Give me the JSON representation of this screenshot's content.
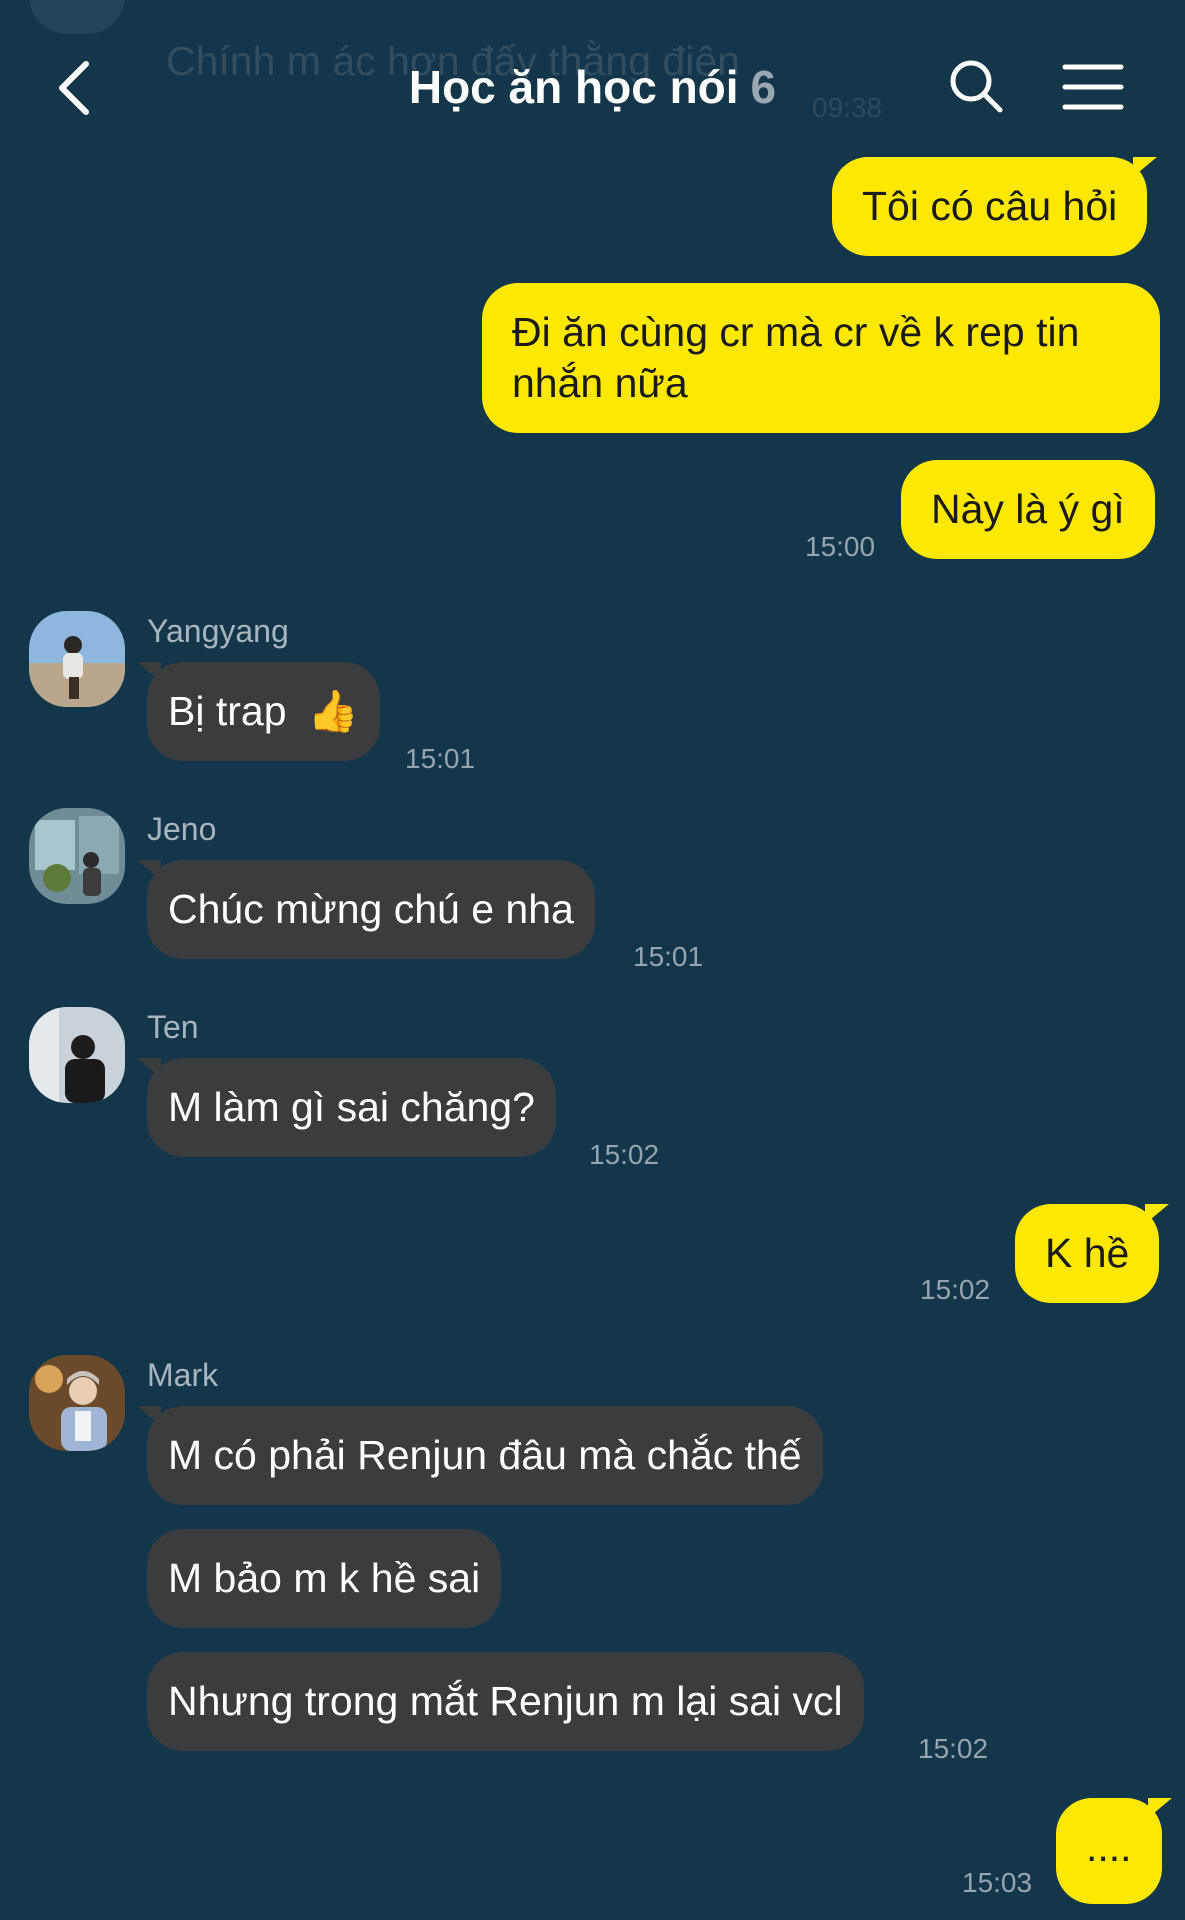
{
  "header": {
    "back_icon": "chevron-left-icon",
    "title": "Học ăn học nói",
    "member_count": "6",
    "search_icon": "search-icon",
    "menu_icon": "hamburger-menu-icon"
  },
  "background_message": {
    "text": "Chính m ác hơn đấy thằng điên",
    "time": "09:38"
  },
  "colors": {
    "background": "#13364a",
    "outgoing_bubble": "#ffe800",
    "incoming_bubble": "#3a3c3e",
    "timestamp": "#97a4ad"
  },
  "messages": [
    {
      "from": "me",
      "text": "Tôi có câu hỏi"
    },
    {
      "from": "me",
      "lines": [
        "Đi ăn cùng cr mà cr về k rep tin",
        "nhắn nữa"
      ]
    },
    {
      "from": "me",
      "text": "Này là ý gì",
      "time": "15:00"
    },
    {
      "from": "Yangyang",
      "sender": "Yangyang",
      "text": "Bị trap",
      "emoji": "👍",
      "time": "15:01"
    },
    {
      "from": "Jeno",
      "sender": "Jeno",
      "text": "Chúc mừng chú e nha",
      "time": "15:01"
    },
    {
      "from": "Ten",
      "sender": "Ten",
      "text": "M làm gì sai chăng?",
      "time": "15:02"
    },
    {
      "from": "me",
      "text": "K hề",
      "time": "15:02"
    },
    {
      "from": "Mark",
      "sender": "Mark",
      "text": "M có phải Renjun đâu mà chắc thế"
    },
    {
      "from": "Mark",
      "text": "M bảo m k hề sai"
    },
    {
      "from": "Mark",
      "text": "Nhưng trong mắt Renjun m lại sai vcl",
      "time": "15:02"
    },
    {
      "from": "me",
      "text": "....",
      "time": "15:03"
    }
  ]
}
